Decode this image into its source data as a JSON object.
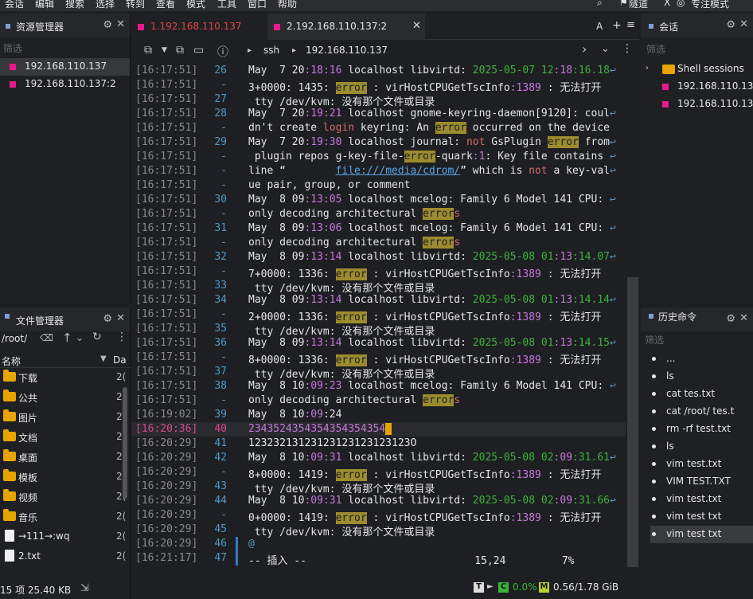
{
  "menu": [
    "会话",
    "编辑",
    "搜索",
    "选择",
    "转到",
    "查看",
    "模式",
    "工具",
    "窗口",
    "帮助"
  ],
  "menu_right": [
    "隧道",
    "X",
    "专注模式"
  ],
  "left_top": {
    "title": "资源管理器",
    "filter": "筛选",
    "sessions": [
      "192.168.110.137",
      "192.168.110.137:2"
    ]
  },
  "left_bottom": {
    "title": "文件管理器",
    "path": "/root/",
    "col_name": "名称",
    "col_size": "Da",
    "files": [
      {
        "name": "下载",
        "size": "2(",
        "type": "folder"
      },
      {
        "name": "公共",
        "size": "2(",
        "type": "folder"
      },
      {
        "name": "图片",
        "size": "2(",
        "type": "folder"
      },
      {
        "name": "文档",
        "size": "2(",
        "type": "folder"
      },
      {
        "name": "桌面",
        "size": "2(",
        "type": "folder"
      },
      {
        "name": "模板",
        "size": "2(",
        "type": "folder"
      },
      {
        "name": "视频",
        "size": "2(",
        "type": "folder"
      },
      {
        "name": "音乐",
        "size": "2(",
        "type": "folder"
      },
      {
        "name": "→111→:wq",
        "size": "2(",
        "type": "file"
      },
      {
        "name": "2.txt",
        "size": "2(",
        "type": "file"
      }
    ],
    "footer": "15 项 25.40 KB"
  },
  "tabs": [
    {
      "label": "1.192.168.110.137",
      "active": false
    },
    {
      "label": "2.192.168.110.137:2",
      "active": true
    }
  ],
  "tab_right": [
    "A",
    "+",
    "≡"
  ],
  "toolbar": {
    "crumb_ssh": "ssh",
    "crumb_host": "192.168.110.137"
  },
  "terminal": [
    {
      "ts": "[16:17:51]",
      "ln": "26",
      "text": "May  7 20:18:16 localhost libvirtd: 2025-05-07 12:18:16.18↩"
    },
    {
      "ts": "[16:17:51]",
      "ln": "-",
      "text": "3+0000: 1435: error : virHostCPUGetTscInfo:1389 : 无法打开"
    },
    {
      "ts": "[16:17:51]",
      "ln": "27",
      "text": " tty /dev/kvm: 没有那个文件或目录"
    },
    {
      "ts": "[16:17:51]",
      "ln": "28",
      "text": "May  7 20:19:21 localhost gnome-keyring-daemon[9120]: coul↩"
    },
    {
      "ts": "[16:17:51]",
      "ln": "-",
      "text": "dn't create login keyring: An error occurred on the device"
    },
    {
      "ts": "[16:17:51]",
      "ln": "29",
      "text": "May  7 20:19:30 localhost journal: not GsPlugin error from↩"
    },
    {
      "ts": "[16:17:51]",
      "ln": "-",
      "text": " plugin repos g-key-file-error-quark:1: Key file contains ↩"
    },
    {
      "ts": "[16:17:51]",
      "ln": "-",
      "text": "line “        file:///media/cdrom/” which is not a key-val↩"
    },
    {
      "ts": "[16:17:51]",
      "ln": "-",
      "text": "ue pair, group, or comment"
    },
    {
      "ts": "[16:17:51]",
      "ln": "30",
      "text": "May  8 09:13:05 localhost mcelog: Family 6 Model 141 CPU: ↩"
    },
    {
      "ts": "[16:17:51]",
      "ln": "-",
      "text": "only decoding architectural errors"
    },
    {
      "ts": "[16:17:51]",
      "ln": "31",
      "text": "May  8 09:13:06 localhost mcelog: Family 6 Model 141 CPU: ↩"
    },
    {
      "ts": "[16:17:51]",
      "ln": "-",
      "text": "only decoding architectural errors"
    },
    {
      "ts": "[16:17:51]",
      "ln": "32",
      "text": "May  8 09:13:14 localhost libvirtd: 2025-05-08 01:13:14.07↩"
    },
    {
      "ts": "[16:17:51]",
      "ln": "-",
      "text": "7+0000: 1336: error : virHostCPUGetTscInfo:1389 : 无法打开"
    },
    {
      "ts": "[16:17:51]",
      "ln": "33",
      "text": " tty /dev/kvm: 没有那个文件或目录"
    },
    {
      "ts": "[16:17:51]",
      "ln": "34",
      "text": "May  8 09:13:14 localhost libvirtd: 2025-05-08 01:13:14.14↩"
    },
    {
      "ts": "[16:17:51]",
      "ln": "-",
      "text": "2+0000: 1336: error : virHostCPUGetTscInfo:1389 : 无法打开"
    },
    {
      "ts": "[16:17:51]",
      "ln": "35",
      "text": " tty /dev/kvm: 没有那个文件或目录"
    },
    {
      "ts": "[16:17:51]",
      "ln": "36",
      "text": "May  8 09:13:14 localhost libvirtd: 2025-05-08 01:13:14.15↩"
    },
    {
      "ts": "[16:17:51]",
      "ln": "-",
      "text": "8+0000: 1336: error : virHostCPUGetTscInfo:1389 : 无法打开"
    },
    {
      "ts": "[16:17:51]",
      "ln": "37",
      "text": " tty /dev/kvm: 没有那个文件或目录"
    },
    {
      "ts": "[16:17:51]",
      "ln": "38",
      "text": "May  8 10:09:23 localhost mcelog: Family 6 Model 141 CPU: ↩"
    },
    {
      "ts": "[16:17:51]",
      "ln": "-",
      "text": "only decoding architectural errors"
    },
    {
      "ts": "[16:19:02]",
      "ln": "39",
      "text": "May  8 10:09:24"
    },
    {
      "ts": "[16:20:36]",
      "ln": "40",
      "text": "2343524354354354354354 "
    },
    {
      "ts": "[16:20:29]",
      "ln": "41",
      "text": "12323213123123123123123123O"
    },
    {
      "ts": "[16:20:29]",
      "ln": "42",
      "text": "May  8 10:09:31 localhost libvirtd: 2025-05-08 02:09:31.61↩"
    },
    {
      "ts": "[16:20:29]",
      "ln": "-",
      "text": "8+0000: 1419: error : virHostCPUGetTscInfo:1389 : 无法打开"
    },
    {
      "ts": "[16:20:29]",
      "ln": "43",
      "text": " tty /dev/kvm: 没有那个文件或目录"
    },
    {
      "ts": "[16:20:29]",
      "ln": "44",
      "text": "May  8 10:09:31 localhost libvirtd: 2025-05-08 02:09:31.66↩"
    },
    {
      "ts": "[16:20:29]",
      "ln": "-",
      "text": "0+0000: 1419: error : virHostCPUGetTscInfo:1389 : 无法打开"
    },
    {
      "ts": "[16:20:29]",
      "ln": "45",
      "text": " tty /dev/kvm: 没有那个文件或目录"
    },
    {
      "ts": "[16:20:29]",
      "ln": "46",
      "text": "@"
    },
    {
      "ts": "[16:21:17]",
      "ln": "47",
      "text": "-- 插入 --                           15,24         7%"
    }
  ],
  "status": {
    "t": "T",
    "c": "C",
    "cpu": "0.0%",
    "m": "M",
    "mem": "0.56/1.78 GiB"
  },
  "right_top": {
    "title": "会话",
    "filter": "筛选",
    "group": "Shell sessions",
    "items": [
      "192.168.110.13",
      "192.168.110.13"
    ]
  },
  "right_bottom": {
    "title": "历史命令",
    "filter": "筛选",
    "items": [
      "...",
      "ls",
      "cat tes.txt",
      "cat /root/ tes.t",
      "rm -rf test.txt",
      "ls",
      "vim test.txt",
      "VIM TEST.TXT",
      "vim test.txt",
      "vim test txt",
      "vim test txt"
    ]
  },
  "colors": {
    "accent": "#e8198c",
    "error_bg": "#9d8c2f",
    "active_tab_text": "#e04646",
    "green": "#3bb33b"
  }
}
